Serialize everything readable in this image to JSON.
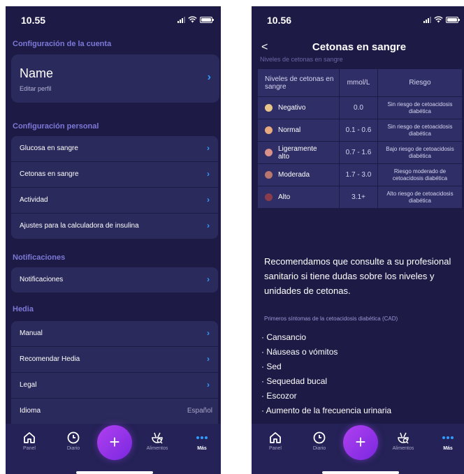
{
  "left_screen": {
    "status_time": "10.55",
    "account_section": "Configuración de la cuenta",
    "profile": {
      "name": "Name",
      "subtitle": "Editar perfil"
    },
    "personal_section": "Configuración personal",
    "personal_items": [
      "Glucosa en sangre",
      "Cetonas en sangre",
      "Actividad",
      "Ajustes para la calculadora de insulina"
    ],
    "notifications_section": "Notificaciones",
    "notifications_items": [
      "Notificaciones"
    ],
    "hedia_section": "Hedia",
    "hedia_items": [
      "Manual",
      "Recomendar Hedia",
      "Legal"
    ],
    "language": {
      "label": "Idioma",
      "value": "Español"
    }
  },
  "right_screen": {
    "status_time": "10.56",
    "title": "Cetonas en sangre",
    "back_glyph": "<",
    "partial_header": "Niveles de cetonas en sangre",
    "table": {
      "headers": [
        "Niveles de cetonas en sangre",
        "mmol/L",
        "Riesgo"
      ],
      "rows": [
        {
          "level": "Negativo",
          "range": "0.0",
          "risk": "Sin riesgo de cetoacidosis diabética",
          "color": "#e8c68a"
        },
        {
          "level": "Normal",
          "range": "0.1 - 0.6",
          "risk": "Sin riesgo de cetoacidosis diabética",
          "color": "#e7a97e"
        },
        {
          "level": "Ligeramente alto",
          "range": "0.7 - 1.6",
          "risk": "Bajo riesgo de cetoacidosis diabética",
          "color": "#d9918a"
        },
        {
          "level": "Moderada",
          "range": "1.7 - 3.0",
          "risk": "Riesgo moderado de cetoacidosis diabética",
          "color": "#b8766f"
        },
        {
          "level": "Alto",
          "range": "3.1+",
          "risk": "Alto riesgo de cetoacidosis diabética",
          "color": "#8b3c4b"
        }
      ]
    },
    "recommendation": "Recomendamos que consulte a su profesional sanitario si tiene dudas sobre los niveles y unidades de cetonas.",
    "symptoms_title": "Primeros síntomas de la cetoacidosis diabética (CAD)",
    "symptoms": [
      "· Cansancio",
      "· Náuseas o vómitos",
      "· Sed",
      "· Sequedad bucal",
      "· Escozor",
      "· Aumento de la frecuencia urinaria"
    ]
  },
  "tabbar": {
    "panel": "Panel",
    "diario": "Diario",
    "add": "+",
    "alimentos": "Alimentos",
    "mas": "Más"
  },
  "colors": {
    "background": "#1d1b45",
    "card": "#2b2a5c",
    "accent_blue": "#2f9cff",
    "section_title": "#7d78d8",
    "fab": "#9b35ec"
  }
}
